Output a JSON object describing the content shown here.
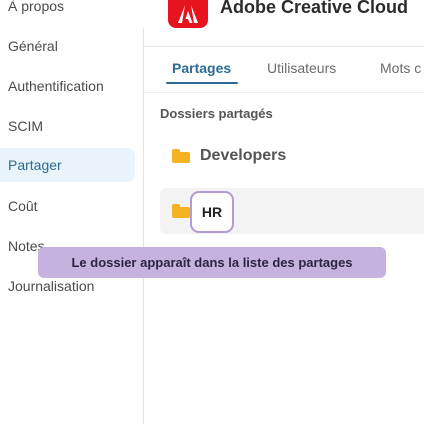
{
  "sidebar": {
    "items": [
      {
        "label": "À propos",
        "active": false
      },
      {
        "label": "Général",
        "active": false
      },
      {
        "label": "Authentification",
        "active": false
      },
      {
        "label": "SCIM",
        "active": false
      },
      {
        "label": "Partager",
        "active": true
      },
      {
        "label": "Coût",
        "active": false
      },
      {
        "label": "Notes",
        "active": false
      },
      {
        "label": "Journalisation",
        "active": false
      }
    ]
  },
  "header": {
    "title": "Adobe Creative Cloud",
    "logo_icon": "adobe-logo-icon",
    "logo_color": "#e8141d"
  },
  "tabs": [
    {
      "label": "Partages",
      "active": true
    },
    {
      "label": "Utilisateurs",
      "active": false
    },
    {
      "label": "Mots c",
      "active": false
    }
  ],
  "section": {
    "title": "Dossiers partagés"
  },
  "folders": [
    {
      "name": "Developers"
    },
    {
      "name": ""
    }
  ],
  "drag_chip": {
    "label": "HR"
  },
  "tooltip": {
    "text": "Le dossier apparaît dans la liste des partages"
  },
  "colors": {
    "accent": "#2c6b93",
    "folder": "#f5b324",
    "tooltip_bg": "#c5b2df",
    "active_bg": "#e8f4fa"
  }
}
